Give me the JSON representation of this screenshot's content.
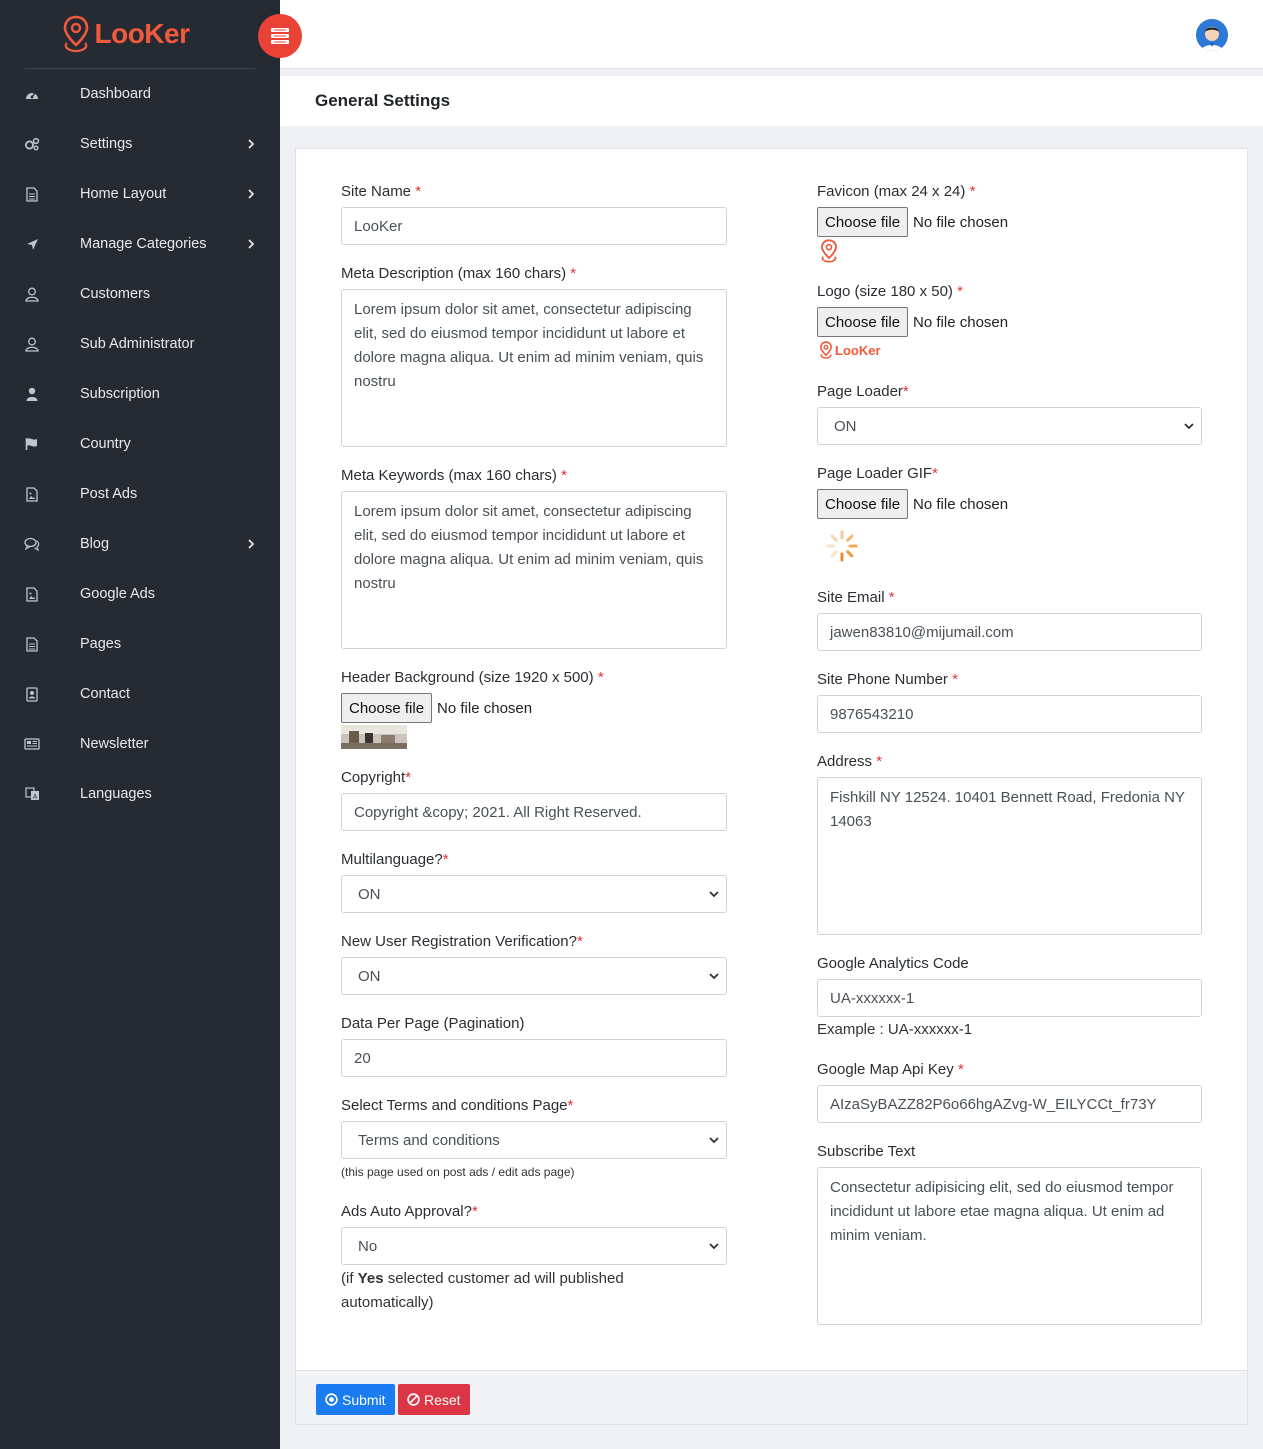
{
  "brand": {
    "name": "LooKer"
  },
  "sidebar": {
    "items": [
      {
        "label": "Dashboard",
        "icon": "dashboard-icon",
        "has_submenu": false
      },
      {
        "label": "Settings",
        "icon": "gears-icon",
        "has_submenu": true
      },
      {
        "label": "Home Layout",
        "icon": "file-icon",
        "has_submenu": true
      },
      {
        "label": "Manage Categories",
        "icon": "location-arrow-icon",
        "has_submenu": true
      },
      {
        "label": "Customers",
        "icon": "user-icon",
        "has_submenu": false
      },
      {
        "label": "Sub Administrator",
        "icon": "user-icon",
        "has_submenu": false
      },
      {
        "label": "Subscription",
        "icon": "user-solid-icon",
        "has_submenu": false
      },
      {
        "label": "Country",
        "icon": "flag-icon",
        "has_submenu": false
      },
      {
        "label": "Post Ads",
        "icon": "image-file-icon",
        "has_submenu": false
      },
      {
        "label": "Blog",
        "icon": "comments-icon",
        "has_submenu": true
      },
      {
        "label": "Google Ads",
        "icon": "image-file-icon",
        "has_submenu": false
      },
      {
        "label": "Pages",
        "icon": "file-icon",
        "has_submenu": false
      },
      {
        "label": "Contact",
        "icon": "contact-card-icon",
        "has_submenu": false
      },
      {
        "label": "Newsletter",
        "icon": "newspaper-icon",
        "has_submenu": false
      },
      {
        "label": "Languages",
        "icon": "language-icon",
        "has_submenu": false
      }
    ]
  },
  "page": {
    "title": "General Settings"
  },
  "form": {
    "site_name": {
      "label": "Site Name",
      "value": "LooKer"
    },
    "meta_description": {
      "label": "Meta Description (max 160 chars)",
      "value": "Lorem ipsum dolor sit amet, consectetur adipiscing elit, sed do eiusmod tempor incididunt ut labore et dolore magna aliqua. Ut enim ad minim veniam, quis nostru"
    },
    "meta_keywords": {
      "label": "Meta Keywords (max 160 chars)",
      "value": "Lorem ipsum dolor sit amet, consectetur adipiscing elit, sed do eiusmod tempor incididunt ut labore et dolore magna aliqua. Ut enim ad minim veniam, quis nostru"
    },
    "header_background": {
      "label": "Header Background (size 1920 x 500)"
    },
    "copyright": {
      "label": "Copyright",
      "value": "Copyright &copy; 2021. All Right Reserved."
    },
    "multilanguage": {
      "label": "Multilanguage?",
      "value": "ON"
    },
    "new_user_verification": {
      "label": "New User Registration Verification?",
      "value": "ON"
    },
    "data_per_page": {
      "label": "Data Per Page (Pagination)",
      "value": "20"
    },
    "terms_page": {
      "label": "Select Terms and conditions Page",
      "value": "Terms and conditions",
      "help": "(this page used on post ads / edit ads page)"
    },
    "ads_auto_approval": {
      "label": "Ads Auto Approval?",
      "value": "No",
      "help_prefix": "(if ",
      "help_bold": "Yes",
      "help_suffix": " selected customer ad will published automatically)"
    },
    "favicon": {
      "label": "Favicon (max 24 x 24)"
    },
    "logo": {
      "label": "Logo (size 180 x 50)",
      "preview_text": "LooKer"
    },
    "page_loader": {
      "label": "Page Loader",
      "value": "ON"
    },
    "page_loader_gif": {
      "label": "Page Loader GIF"
    },
    "site_email": {
      "label": "Site Email",
      "value": "jawen83810@mijumail.com"
    },
    "site_phone": {
      "label": "Site Phone Number",
      "value": "9876543210"
    },
    "address": {
      "label": "Address",
      "value": "Fishkill NY 12524. 10401 Bennett Road, Fredonia NY 14063"
    },
    "google_analytics": {
      "label": "Google Analytics Code",
      "value": "UA-xxxxxx-1",
      "help": "Example : UA-xxxxxx-1"
    },
    "google_map_key": {
      "label": "Google Map Api Key",
      "value": "AIzaSyBAZZ82P6o66hgAZvg-W_EILYCCt_fr73Y"
    },
    "subscribe_text": {
      "label": "Subscribe Text",
      "value": "Consectetur adipisicing elit, sed do eiusmod tempor incididunt ut labore etae magna aliqua. Ut enim ad minim veniam."
    },
    "file_button": "Choose file",
    "no_file": "No file chosen",
    "required_mark": "*"
  },
  "actions": {
    "submit": "Submit",
    "reset": "Reset"
  },
  "colors": {
    "sidebar": "#262b33",
    "accent": "#ef5a3c",
    "primary": "#1a7cf0",
    "danger": "#dc3545"
  }
}
